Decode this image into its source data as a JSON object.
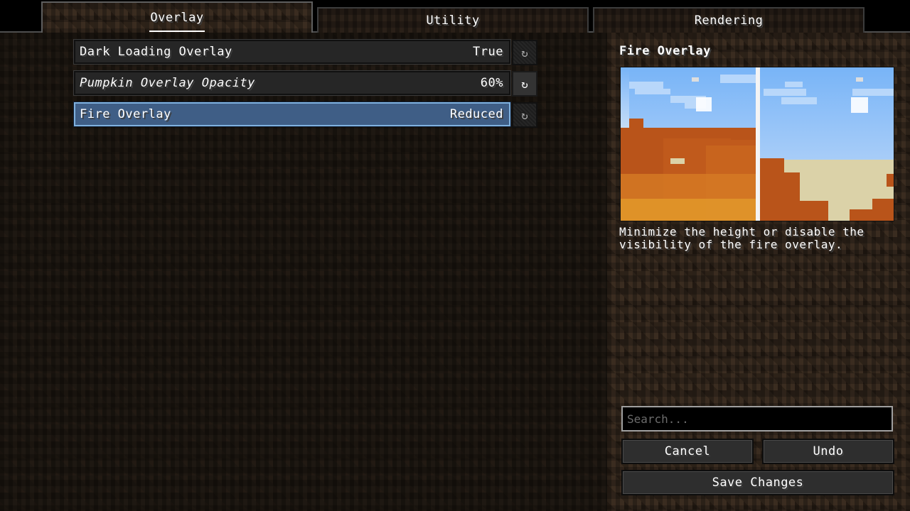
{
  "tabs": [
    {
      "label": "Overlay",
      "active": true
    },
    {
      "label": "Utility",
      "active": false
    },
    {
      "label": "Rendering",
      "active": false
    }
  ],
  "options": [
    {
      "label": "Dark Loading Overlay",
      "value": "True",
      "italic": false,
      "selected": false,
      "reset_enabled": false
    },
    {
      "label": "Pumpkin Overlay Opacity",
      "value": "60%",
      "italic": true,
      "selected": false,
      "reset_enabled": true
    },
    {
      "label": "Fire Overlay",
      "value": "Reduced",
      "italic": false,
      "selected": true,
      "reset_enabled": false
    }
  ],
  "reset_icon": "↻",
  "side_panel": {
    "title": "Fire Overlay",
    "preview_alt": "Fire overlay comparison: default vs reduced",
    "description": "Minimize the height or disable the visibility of the fire overlay."
  },
  "search": {
    "placeholder": "Search...",
    "value": ""
  },
  "buttons": {
    "cancel": "Cancel",
    "undo": "Undo",
    "save": "Save Changes"
  },
  "colors": {
    "selected_row": "#3f5e86",
    "selected_border": "#7fb1de",
    "sky": "#7db7f8",
    "fire_dark": "#b9541a",
    "fire_light": "#dc8a22",
    "sand": "#dbd2a8"
  }
}
